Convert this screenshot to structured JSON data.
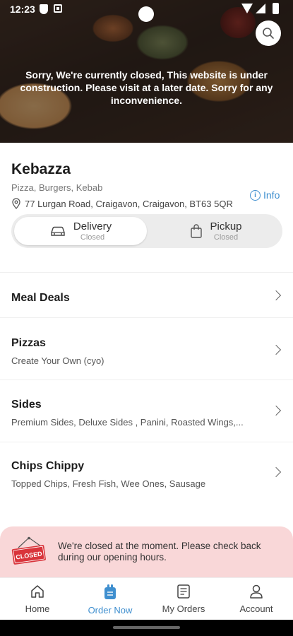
{
  "status_bar": {
    "time": "12:23"
  },
  "hero": {
    "message": "Sorry, We're currently closed, This website is under construction. Please visit at a later date. Sorry for any inconvenience."
  },
  "restaurant": {
    "name": "Kebazza",
    "cuisine": "Pizza, Burgers, Kebab",
    "address": "77 Lurgan Road, Craigavon, Craigavon, BT63 5QR",
    "info_label": "Info"
  },
  "order_mode": {
    "delivery": {
      "label": "Delivery",
      "status": "Closed"
    },
    "pickup": {
      "label": "Pickup",
      "status": "Closed"
    }
  },
  "categories": [
    {
      "title": "Meal Deals",
      "subtitle": ""
    },
    {
      "title": "Pizzas",
      "subtitle": "Create Your Own (cyo)"
    },
    {
      "title": "Sides",
      "subtitle": "Premium Sides, Deluxe Sides , Panini, Roasted Wings,..."
    },
    {
      "title": "Chips Chippy",
      "subtitle": "Topped Chips, Fresh Fish, Wee Ones, Sausage"
    }
  ],
  "closed_banner": {
    "sign_text": "CLOSED",
    "message": "We're closed at the moment. Please check back during our opening hours."
  },
  "bottom_nav": [
    {
      "label": "Home",
      "icon": "home-icon"
    },
    {
      "label": "Order Now",
      "icon": "order-bag-icon"
    },
    {
      "label": "My Orders",
      "icon": "receipt-icon"
    },
    {
      "label": "Account",
      "icon": "user-icon"
    }
  ],
  "colors": {
    "accent": "#3f8fcf",
    "banner_bg": "#f9d7d8",
    "closed_sign": "#d9343b"
  }
}
